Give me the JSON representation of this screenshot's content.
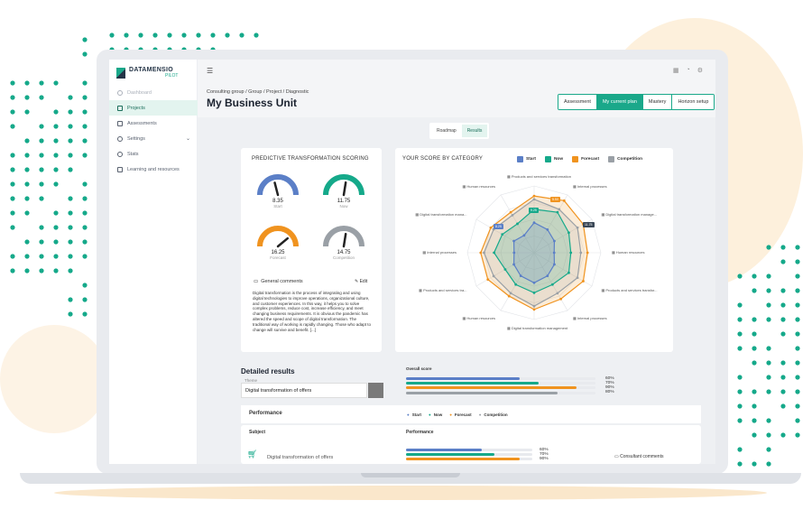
{
  "colors": {
    "start": "#5b7fc7",
    "now": "#15a98a",
    "forecast": "#f0931f",
    "competition": "#9aa0a6",
    "accent": "#1aa88a"
  },
  "brand": {
    "name": "DATAMENSIO",
    "sub": "PILOT"
  },
  "sidebar": {
    "items": [
      {
        "label": "Dashboard",
        "icon": "dashboard-icon"
      },
      {
        "label": "Projects",
        "icon": "folder-icon"
      },
      {
        "label": "Assessments",
        "icon": "clipboard-icon"
      },
      {
        "label": "Settings",
        "icon": "gear-icon"
      },
      {
        "label": "Stats",
        "icon": "stats-icon"
      },
      {
        "label": "Learning and resources",
        "icon": "book-icon"
      }
    ]
  },
  "header": {
    "breadcrumb": "Consulting group / Group / Project / Diagnostic",
    "title": "My Business Unit"
  },
  "tabs": [
    "Assessment",
    "My current plan",
    "Mastery",
    "Horizon setup"
  ],
  "subtabs": [
    "Roadmap",
    "Results"
  ],
  "scoring": {
    "title": "PREDICTIVE TRANSFORMATION SCORING",
    "gauges": [
      {
        "value": "8.35",
        "label": "Start",
        "level": 0.42
      },
      {
        "value": "11.75",
        "label": "Now",
        "level": 0.55
      },
      {
        "value": "16.25",
        "label": "Forecast",
        "level": 0.78
      },
      {
        "value": "14.75",
        "label": "Competition",
        "level": 0.55
      }
    ],
    "comments_title": "General comments",
    "edit_label": "Edit",
    "comments_text": "Digital transformation is the process of integrating and using digital technologies to improve operations, organizational culture, and customer experiences. In this way, it helps you to solve complex problems, reduce cost, increase efficiency, and meet changing business requirements. It is obvious the pandemic has altered the speed and scope of digital transformation. The traditional way of working is rapidly changing. Those who adapt to change will survive and benefit. [...]"
  },
  "radar": {
    "title": "YOUR SCORE BY CATEGORY",
    "legend": [
      "Start",
      "Now",
      "Forecast",
      "Competition"
    ],
    "labels": [
      "Products and services transformation",
      "Internal processes",
      "Digital transformation manage...",
      "Human resources",
      "Products and services transfor...",
      "Internal processes",
      "Digital transformation management",
      "Human resources",
      "Products and services tra...",
      "Internal processes",
      "Digital transformation mana...",
      "Human resources"
    ],
    "tags": [
      "8.25",
      "9.25",
      "5.50",
      "11.75"
    ]
  },
  "chart_data": {
    "type": "radar",
    "categories": [
      "Products and services transformation",
      "Internal processes",
      "Digital transformation manage...",
      "Human resources",
      "Products and services transfor...",
      "Internal processes",
      "Digital transformation management",
      "Human resources",
      "Products and services tra...",
      "Internal processes",
      "Digital transformation mana...",
      "Human resources"
    ],
    "series": [
      {
        "name": "Start",
        "values": [
          0.45,
          0.4,
          0.35,
          0.3,
          0.35,
          0.4,
          0.45,
          0.4,
          0.35,
          0.3,
          0.35,
          0.3
        ]
      },
      {
        "name": "Now",
        "values": [
          0.65,
          0.7,
          0.6,
          0.55,
          0.6,
          0.55,
          0.6,
          0.55,
          0.5,
          0.6,
          0.55,
          0.5
        ]
      },
      {
        "name": "Forecast",
        "values": [
          0.85,
          0.9,
          0.85,
          0.8,
          0.85,
          0.8,
          0.85,
          0.75,
          0.8,
          0.8,
          0.75,
          0.7
        ]
      },
      {
        "name": "Competition",
        "values": [
          0.8,
          0.75,
          0.75,
          0.7,
          0.75,
          0.7,
          0.8,
          0.7,
          0.7,
          0.75,
          0.7,
          0.65
        ]
      }
    ]
  },
  "detailed": {
    "title": "Detailed results",
    "theme_label": "Theme",
    "theme_value": "Digital transformation of offers",
    "overall_label": "Overall score",
    "overall": [
      {
        "name": "Start",
        "value": 0.6,
        "label": "60%"
      },
      {
        "name": "Now",
        "value": 0.7,
        "label": "70%"
      },
      {
        "name": "Forecast",
        "value": 0.9,
        "label": "90%"
      },
      {
        "name": "Competition",
        "value": 0.8,
        "label": "80%"
      }
    ],
    "performance_label": "Performance",
    "legend": [
      "Start",
      "Now",
      "Forecast",
      "Competition"
    ],
    "subject_header": "Subject",
    "perf_header": "Performance",
    "row": {
      "subject": "Digital transformation of offers",
      "bars": [
        {
          "name": "Start",
          "value": 0.6,
          "label": "60%"
        },
        {
          "name": "Now",
          "value": 0.7,
          "label": "70%"
        },
        {
          "name": "Forecast",
          "value": 0.9,
          "label": "90%"
        }
      ],
      "comment_label": "Consultant comments"
    }
  }
}
